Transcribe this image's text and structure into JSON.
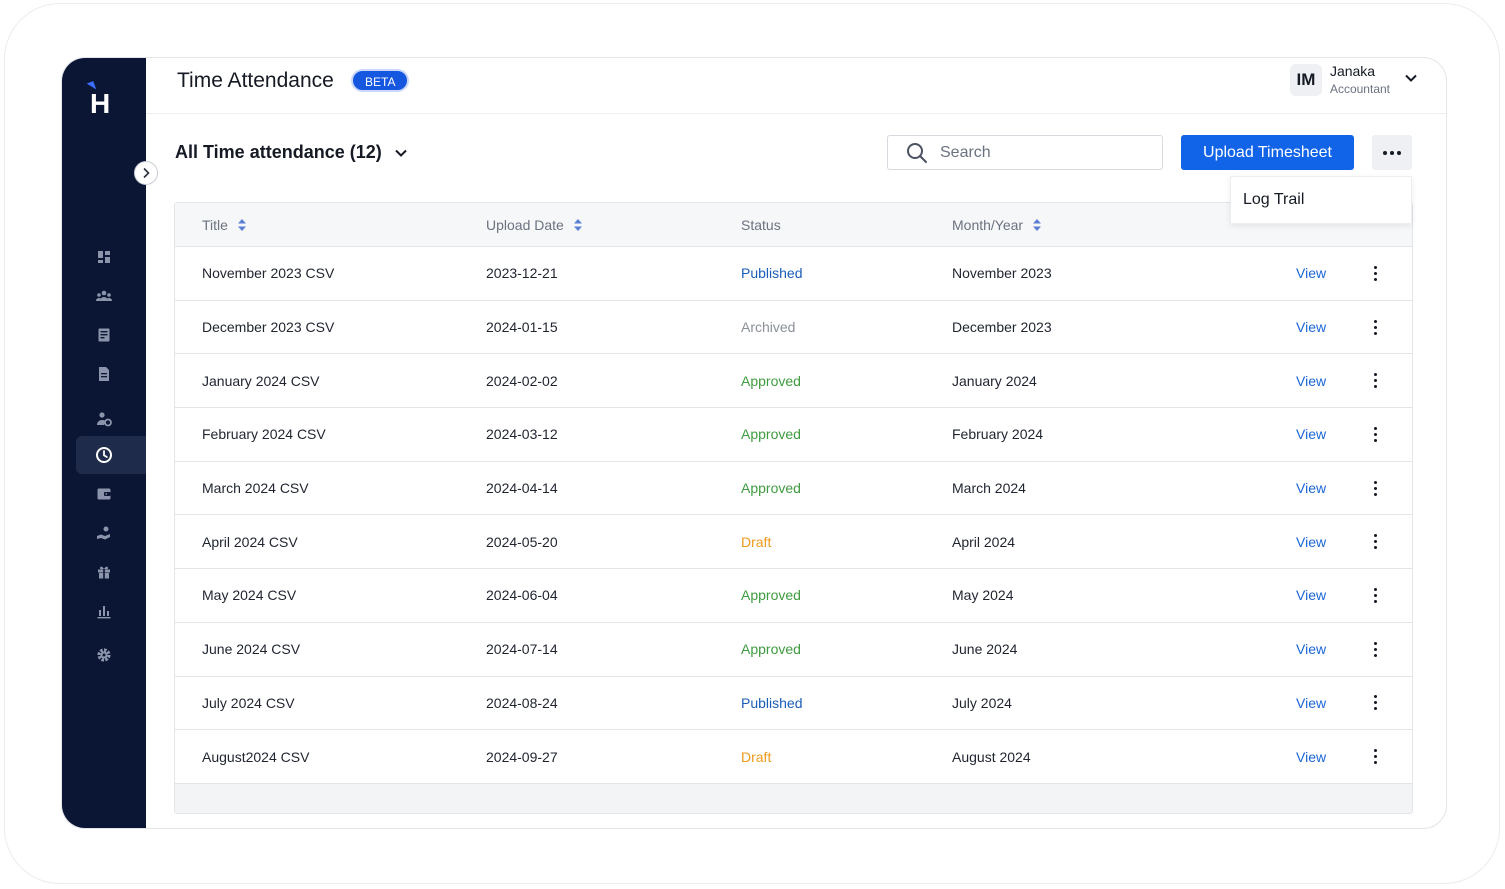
{
  "app": {
    "logo_letter": "H",
    "page_title": "Time Attendance",
    "beta_label": "BETA"
  },
  "user": {
    "initials": "IM",
    "name": "Janaka",
    "role": "Accountant"
  },
  "sidebar": {
    "items": [
      {
        "icon": "dashboard-icon",
        "active": false
      },
      {
        "icon": "employees-icon",
        "active": false
      },
      {
        "icon": "reports-icon",
        "active": false
      },
      {
        "icon": "document-icon",
        "active": false
      },
      {
        "icon": "people-settings-icon",
        "active": false
      },
      {
        "icon": "clock-icon",
        "active": true
      },
      {
        "icon": "wallet-icon",
        "active": false
      },
      {
        "icon": "benefits-icon",
        "active": false
      },
      {
        "icon": "gift-icon",
        "active": false
      },
      {
        "icon": "analytics-icon",
        "active": false
      },
      {
        "icon": "settings-icon",
        "active": false
      }
    ]
  },
  "toolbar": {
    "list_title": "All Time attendance (12)",
    "search_placeholder": "Search",
    "upload_label": "Upload Timesheet",
    "dropdown_item": "Log Trail"
  },
  "table": {
    "columns": {
      "title": "Title",
      "upload_date": "Upload Date",
      "status": "Status",
      "month_year": "Month/Year"
    },
    "rows": [
      {
        "title": "November 2023 CSV",
        "date": "2023-12-21",
        "status": "Published",
        "month": "November 2023",
        "action": "View"
      },
      {
        "title": "December 2023 CSV",
        "date": "2024-01-15",
        "status": "Archived",
        "month": "December 2023",
        "action": "View"
      },
      {
        "title": "January 2024 CSV",
        "date": "2024-02-02",
        "status": "Approved",
        "month": "January 2024",
        "action": "View"
      },
      {
        "title": "February 2024 CSV",
        "date": "2024-03-12",
        "status": "Approved",
        "month": "February 2024",
        "action": "View"
      },
      {
        "title": "March 2024 CSV",
        "date": "2024-04-14",
        "status": "Approved",
        "month": "March 2024",
        "action": "View"
      },
      {
        "title": "April 2024 CSV",
        "date": "2024-05-20",
        "status": "Draft",
        "month": "April 2024",
        "action": "View"
      },
      {
        "title": "May 2024 CSV",
        "date": "2024-06-04",
        "status": "Approved",
        "month": "May 2024",
        "action": "View"
      },
      {
        "title": "June 2024 CSV",
        "date": "2024-07-14",
        "status": "Approved",
        "month": "June 2024",
        "action": "View"
      },
      {
        "title": "July 2024 CSV",
        "date": "2024-08-24",
        "status": "Published",
        "month": "July 2024",
        "action": "View"
      },
      {
        "title": "August2024 CSV",
        "date": "2024-09-27",
        "status": "Draft",
        "month": "August 2024",
        "action": "View"
      }
    ]
  },
  "colors": {
    "sidebar_bg": "#0a1634",
    "accent": "#1163e8",
    "published": "#1a5db8",
    "archived": "#8a8f98",
    "approved": "#3f9b3f",
    "draft": "#ef9a1c"
  }
}
